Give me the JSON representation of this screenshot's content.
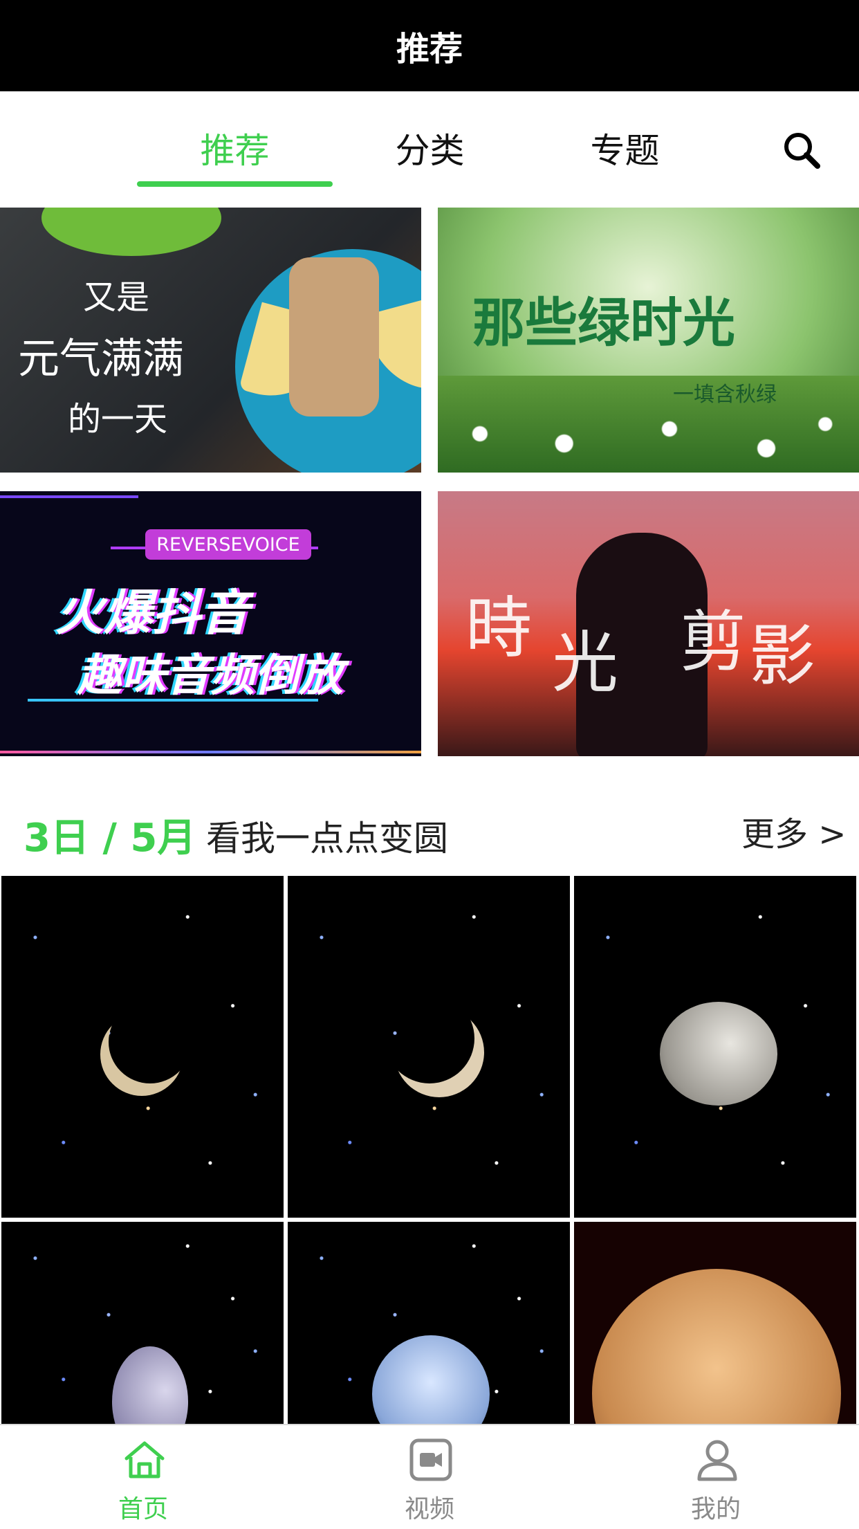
{
  "header": {
    "title": "推荐"
  },
  "tabs": [
    {
      "label": "推荐",
      "active": true
    },
    {
      "label": "分类",
      "active": false
    },
    {
      "label": "专题",
      "active": false
    }
  ],
  "search": {
    "icon": "search-icon"
  },
  "banners": [
    {
      "line1": "又是",
      "line2": "元气满满",
      "line3": "的一天"
    },
    {
      "title": "那些绿时光",
      "subtitle": "一填含秋绿"
    },
    {
      "badge": "REVERSEVOICE",
      "line1": "火爆抖音",
      "line2": "趣味音频倒放"
    },
    {
      "c1": "時",
      "c2": "光",
      "c3": "剪",
      "c4": "影"
    }
  ],
  "section": {
    "date": "3日 / 5月",
    "title": "看我一点点变圆",
    "more": "更多 >"
  },
  "bottom_nav": [
    {
      "label": "首页",
      "icon": "home-icon",
      "active": true
    },
    {
      "label": "视频",
      "icon": "video-icon",
      "active": false
    },
    {
      "label": "我的",
      "icon": "user-icon",
      "active": false
    }
  ],
  "colors": {
    "accent": "#3fcf4f",
    "header_bg": "#000000"
  }
}
